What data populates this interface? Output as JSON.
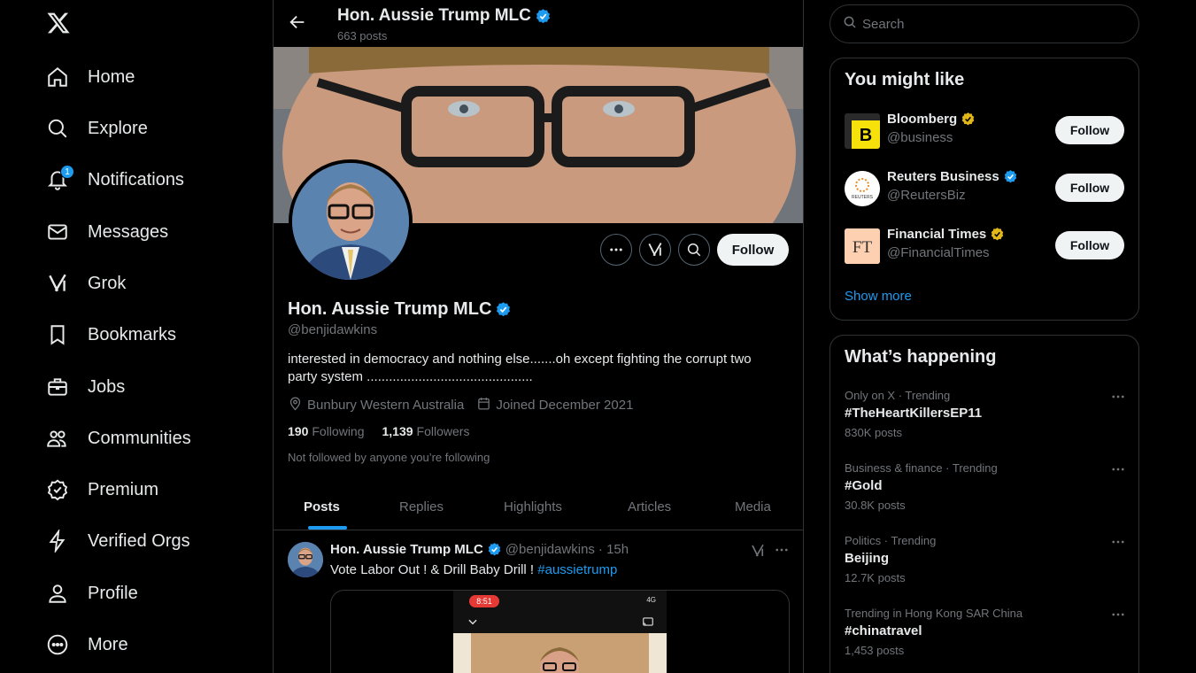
{
  "nav": {
    "items": [
      {
        "label": "Home"
      },
      {
        "label": "Explore"
      },
      {
        "label": "Notifications",
        "badge": "1"
      },
      {
        "label": "Messages"
      },
      {
        "label": "Grok"
      },
      {
        "label": "Bookmarks"
      },
      {
        "label": "Jobs"
      },
      {
        "label": "Communities"
      },
      {
        "label": "Premium"
      },
      {
        "label": "Verified Orgs"
      },
      {
        "label": "Profile"
      },
      {
        "label": "More"
      }
    ]
  },
  "header": {
    "name": "Hon. Aussie Trump MLC",
    "posts_count": "663 posts"
  },
  "profile": {
    "name": "Hon. Aussie Trump MLC",
    "handle": "@benjidawkins",
    "bio": "interested in democracy and nothing else.......oh except fighting the corrupt two party system .............................................",
    "location": "Bunbury Western Australia",
    "joined": "Joined December 2021",
    "following_count": "190",
    "following_label": "Following",
    "followers_count": "1,139",
    "followers_label": "Followers",
    "not_followed": "Not followed by anyone you’re following",
    "follow_label": "Follow"
  },
  "tabs": [
    {
      "label": "Posts",
      "active": true
    },
    {
      "label": "Replies"
    },
    {
      "label": "Highlights"
    },
    {
      "label": "Articles"
    },
    {
      "label": "Media"
    }
  ],
  "post": {
    "name": "Hon. Aussie Trump MLC",
    "handle": "@benjidawkins",
    "time": "· 15h",
    "text": "Vote Labor Out ! & Drill Baby Drill ! ",
    "hashtag": "#aussietrump",
    "phone_time": "8:51",
    "phone_status": "4G"
  },
  "search": {
    "placeholder": "Search"
  },
  "you_might_like": {
    "title": "You might like",
    "accounts": [
      {
        "name": "Bloomberg",
        "handle": "@business",
        "badge_color": "#e2b719",
        "follow_label": "Follow"
      },
      {
        "name": "Reuters Business",
        "handle": "@ReutersBiz",
        "badge_color": "#1d9bf0",
        "follow_label": "Follow"
      },
      {
        "name": "Financial Times",
        "handle": "@FinancialTimes",
        "badge_color": "#e2b719",
        "follow_label": "Follow"
      }
    ],
    "show_more": "Show more"
  },
  "whats_happening": {
    "title": "What’s happening",
    "trends": [
      {
        "context": "Only on X · Trending",
        "topic": "#TheHeartKillersEP11",
        "count": "830K posts"
      },
      {
        "context": "Business & finance · Trending",
        "topic": "#Gold",
        "count": "30.8K posts"
      },
      {
        "context": "Politics · Trending",
        "topic": "Beijing",
        "count": "12.7K posts"
      },
      {
        "context": "Trending in Hong Kong SAR China",
        "topic": "#chinatravel",
        "count": "1,453 posts"
      }
    ]
  },
  "colors": {
    "accent": "#1d9bf0",
    "background": "#000000",
    "border": "#2f3336",
    "muted_text": "#71767b",
    "gold_badge": "#e2b719"
  }
}
